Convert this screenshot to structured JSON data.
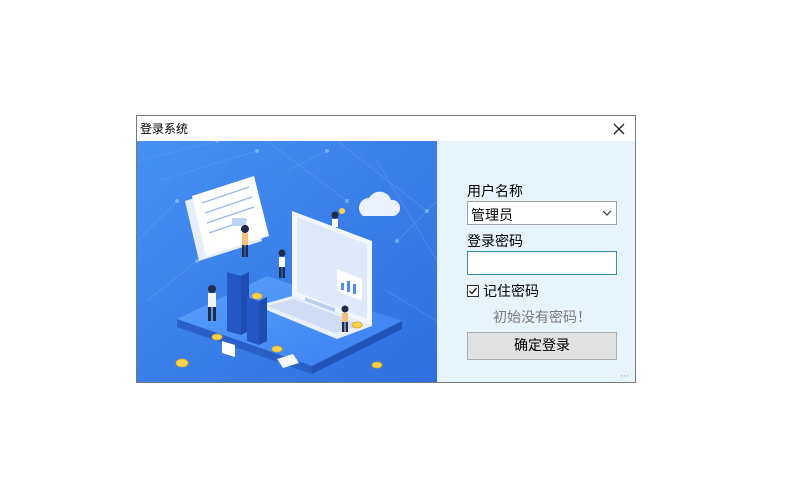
{
  "window": {
    "title": "登录系统"
  },
  "form": {
    "username_label": "用户名称",
    "username_value": "管理员",
    "password_label": "登录密码",
    "password_value": "",
    "remember_label": "记住密码",
    "remember_checked": true,
    "hint_text": "初始没有密码！",
    "login_button": "确定登录"
  },
  "colors": {
    "banner_bg": "#3b82ec",
    "panel_bg": "#e8f4fc",
    "password_border": "#3c8fa0"
  },
  "icons": {
    "close": "close-icon",
    "dropdown": "chevron-down-icon",
    "checkbox": "checkmark-icon",
    "grip": "resize-grip-icon"
  }
}
